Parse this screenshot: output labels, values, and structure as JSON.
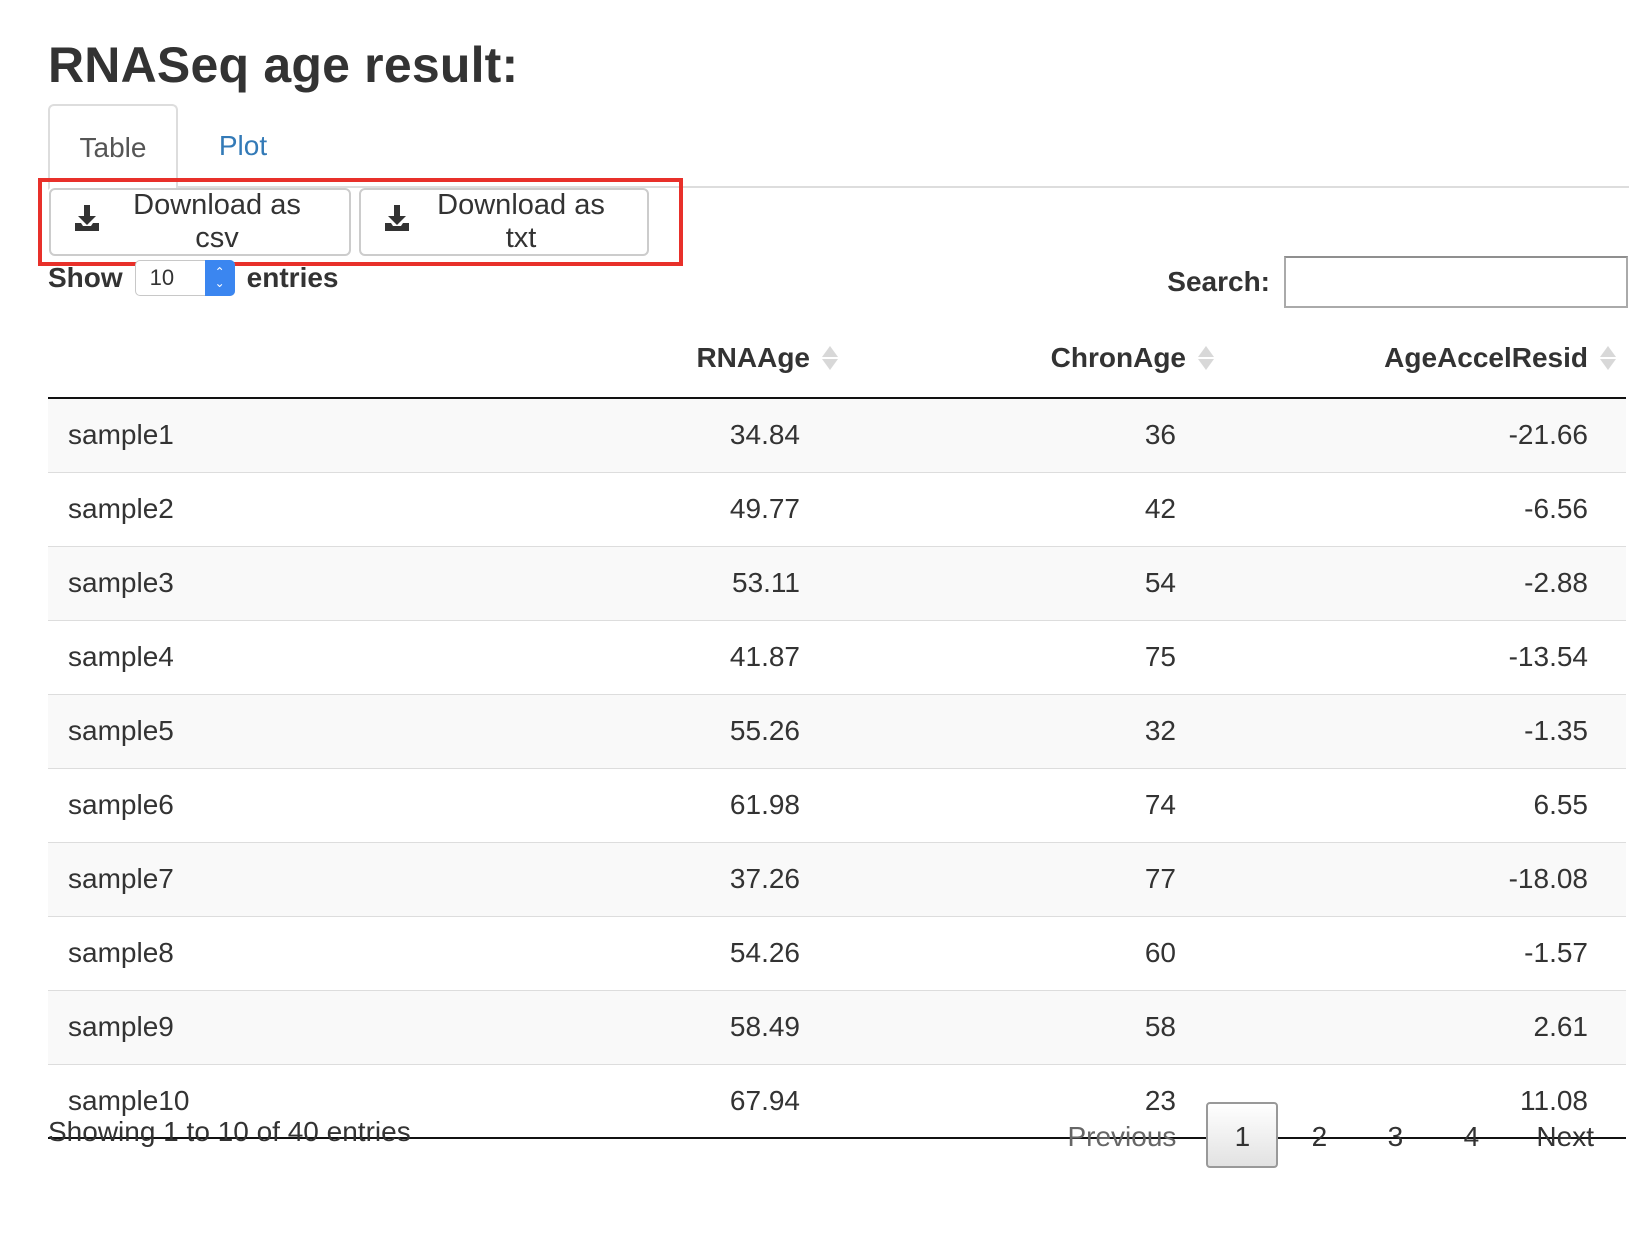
{
  "page_title": "RNASeq age result:",
  "tabs": [
    {
      "label": "Table",
      "active": true
    },
    {
      "label": "Plot",
      "active": false
    }
  ],
  "downloads": {
    "csv_label": "Download as csv",
    "txt_label": "Download as txt",
    "icon": "download-icon"
  },
  "length": {
    "show_label": "Show",
    "selected": "10",
    "entries_label": "entries"
  },
  "search": {
    "label": "Search:",
    "value": ""
  },
  "table": {
    "columns": [
      "",
      "RNAAge",
      "ChronAge",
      "AgeAccelResid"
    ],
    "rows": [
      [
        "sample1",
        "34.84",
        "36",
        "-21.66"
      ],
      [
        "sample2",
        "49.77",
        "42",
        "-6.56"
      ],
      [
        "sample3",
        "53.11",
        "54",
        "-2.88"
      ],
      [
        "sample4",
        "41.87",
        "75",
        "-13.54"
      ],
      [
        "sample5",
        "55.26",
        "32",
        "-1.35"
      ],
      [
        "sample6",
        "61.98",
        "74",
        "6.55"
      ],
      [
        "sample7",
        "37.26",
        "77",
        "-18.08"
      ],
      [
        "sample8",
        "54.26",
        "60",
        "-1.57"
      ],
      [
        "sample9",
        "58.49",
        "58",
        "2.61"
      ],
      [
        "sample10",
        "67.94",
        "23",
        "11.08"
      ]
    ]
  },
  "footer": {
    "info": "Showing 1 to 10 of 40 entries",
    "previous": "Previous",
    "pages": [
      "1",
      "2",
      "3",
      "4"
    ],
    "current_page": "1",
    "next": "Next"
  },
  "colors": {
    "highlight": "#e8302a",
    "link": "#337ab7",
    "select_spinner": "#3b86f0"
  }
}
